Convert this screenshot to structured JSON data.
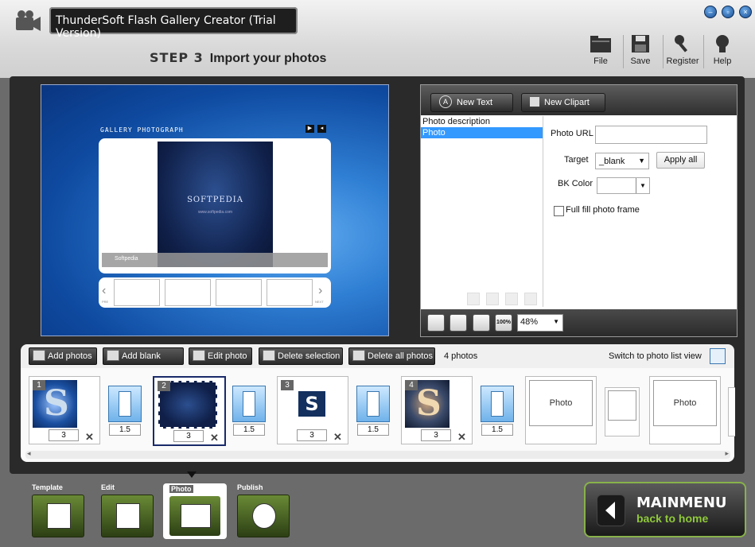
{
  "window": {
    "title": "ThunderSoft Flash Gallery Creator (Trial Version)"
  },
  "step": {
    "number": "STEP 3",
    "title": "Import your photos"
  },
  "toolbar": {
    "file": "File",
    "save": "Save",
    "register": "Register",
    "help": "Help"
  },
  "preview": {
    "gallery_title": "GALLERY PHOTOGRAPH",
    "photo_brand": "SOFTPEDIA",
    "photo_url": "www.softpedia.com",
    "caption": "Softpedia",
    "prev_label": "PRE",
    "next_label": "NEXT"
  },
  "right_panel": {
    "new_text": "New Text",
    "new_clipart": "New Clipart",
    "list_items": [
      "Photo description",
      "Photo"
    ],
    "photo_url_label": "Photo URL",
    "photo_url_value": "",
    "target_label": "Target",
    "target_value": "_blank",
    "apply_all": "Apply all",
    "bk_color_label": "BK Color",
    "full_fill_label": "Full fill photo frame",
    "zoom_value": "48%",
    "zoom_100": "100%"
  },
  "strip_toolbar": {
    "add_photos": "Add photos",
    "add_blank": "Add blank frame",
    "edit_photo": "Edit photo",
    "delete_selection": "Delete selection",
    "delete_all": "Delete all photos",
    "count": "4 photos",
    "switch_view": "Switch to photo list view"
  },
  "strip": {
    "photos": [
      {
        "index": "1",
        "duration": "3"
      },
      {
        "index": "2",
        "duration": "3"
      },
      {
        "index": "3",
        "duration": "3"
      },
      {
        "index": "4",
        "duration": "3"
      }
    ],
    "transitions": [
      "1.5",
      "1.5",
      "1.5",
      "1.5"
    ],
    "placeholder_label": "Photo"
  },
  "steps": {
    "template": "Template",
    "edit": "Edit",
    "photo": "Photo",
    "publish": "Publish"
  },
  "mainmenu": {
    "title": "MAINMENU",
    "subtitle": "back to home"
  },
  "colors": {
    "accent_green": "#8fc93a",
    "selection_blue": "#3399ff",
    "dark_panel": "#2a2a2a"
  }
}
